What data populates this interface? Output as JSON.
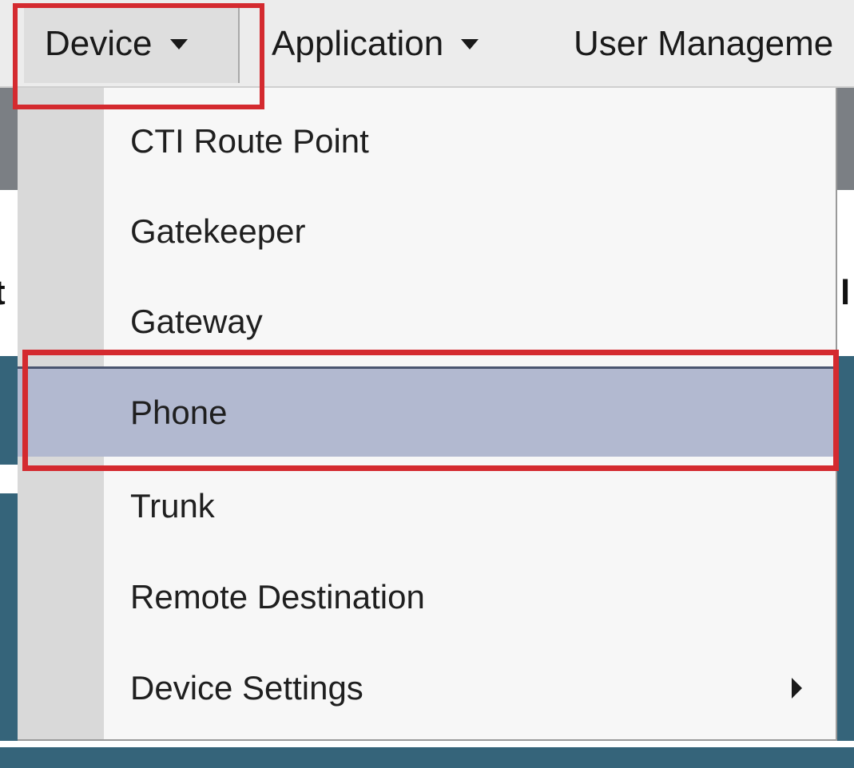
{
  "menubar": {
    "items": [
      {
        "label": "Device"
      },
      {
        "label": "Application"
      },
      {
        "label": "User Manageme"
      }
    ]
  },
  "dropdown": {
    "items": [
      {
        "label": "CTI Route Point"
      },
      {
        "label": "Gatekeeper"
      },
      {
        "label": "Gateway"
      },
      {
        "label": "Phone"
      },
      {
        "label": "Trunk"
      },
      {
        "label": "Remote Destination"
      },
      {
        "label": "Device Settings"
      }
    ],
    "selected_label": "Phone"
  },
  "background": {
    "edge_glyphs": [
      "t",
      "l"
    ]
  },
  "colors": {
    "highlight_border": "#d42a2f",
    "selected_item_bg": "#b2b9d0",
    "page_teal": "#35647a",
    "page_gray": "#7b7f84"
  }
}
